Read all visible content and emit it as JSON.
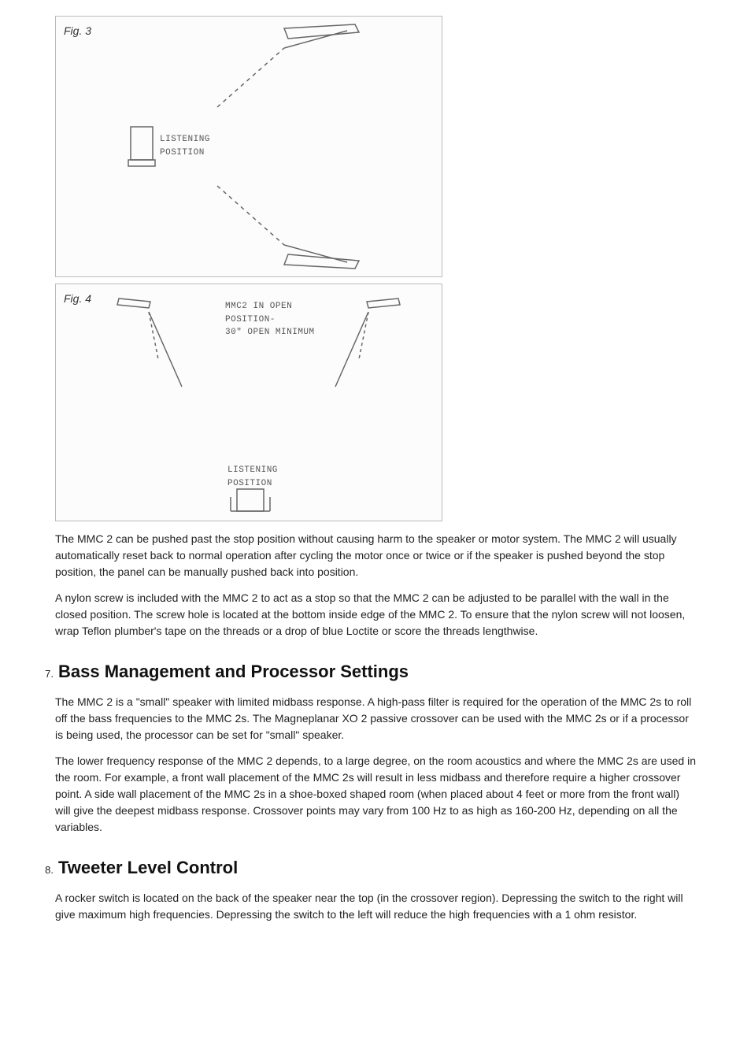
{
  "figures": {
    "fig3": {
      "label": "Fig. 3",
      "listening_position": "LISTENING\nPOSITION"
    },
    "fig4": {
      "label": "Fig. 4",
      "mmc_text": "MMC2 IN OPEN\nPOSITION-\n30\" OPEN MINIMUM",
      "listening_position": "LISTENING\nPOSITION"
    }
  },
  "paragraphs": {
    "p1": "The MMC 2 can be pushed past the stop position without causing harm to the speaker or motor system. The MMC 2 will usually automatically reset back to normal operation after cycling the motor once or twice or if the speaker is pushed beyond the stop position, the panel can be manually pushed back into position.",
    "p2": "A nylon screw is included with the MMC 2 to act as a stop so that the MMC 2 can be adjusted to be parallel with the wall in the closed position. The screw hole is located at the bottom inside edge of the MMC 2. To ensure that the nylon screw will not loosen, wrap Teflon plumber's tape on the threads or a drop of blue Loctite or score the threads lengthwise."
  },
  "sections": {
    "s7": {
      "number": "7.",
      "title": "Bass Management and Processor Settings",
      "p1": "The MMC 2 is a \"small\" speaker with limited midbass response. A high-pass filter is required for the operation of the MMC 2s to roll off the bass frequencies to the MMC 2s. The Magneplanar XO 2 passive crossover can be used with the MMC 2s or if a processor is being used, the processor can be set for \"small\" speaker.",
      "p2": "The lower frequency response of the MMC 2 depends, to a large degree, on the room acoustics and where the MMC 2s are used in the room. For example, a front wall placement of the MMC 2s will result in less midbass and therefore require a higher crossover point. A side wall placement of the MMC 2s in a shoe-boxed shaped room (when placed about 4 feet or more from the front wall) will give the deepest midbass response. Crossover points may vary from 100 Hz to as high as 160-200 Hz, depending on all the variables."
    },
    "s8": {
      "number": "8.",
      "title": "Tweeter Level Control",
      "p1": "A rocker switch is located on the back of the speaker near the top (in the crossover region). Depressing the switch to the right will give maximum high frequencies. Depressing the switch to the left will reduce the high frequencies with a 1 ohm resistor."
    }
  }
}
